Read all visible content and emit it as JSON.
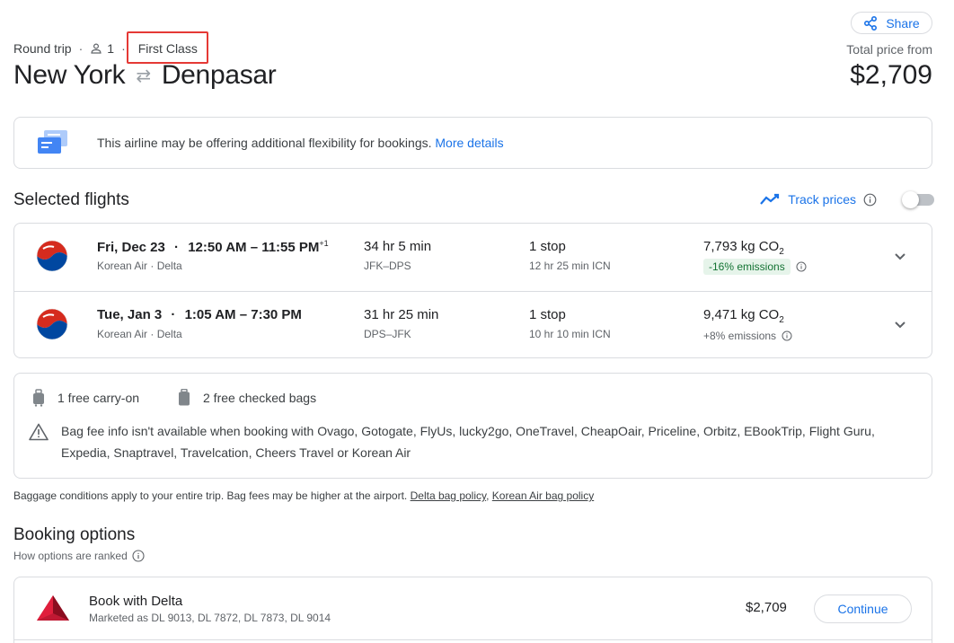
{
  "header": {
    "share_label": "Share",
    "trip_type": "Round trip",
    "passengers": "1",
    "cabin_class": "First Class",
    "origin": "New York",
    "destination": "Denpasar",
    "total_label": "Total price from",
    "total_price": "$2,709"
  },
  "notice": {
    "text": "This airline may be offering additional flexibility for bookings.",
    "link": "More details"
  },
  "selected_flights": {
    "title": "Selected flights",
    "track_label": "Track prices",
    "track_enabled": false,
    "flights": [
      {
        "date": "Fri, Dec 23",
        "times": "12:50 AM – 11:55 PM",
        "day_offset": "+1",
        "carrier": "Korean Air · Delta",
        "duration": "34 hr 5 min",
        "route": "JFK–DPS",
        "stops": "1 stop",
        "layover": "12 hr 25 min ICN",
        "co2": "7,793 kg CO",
        "co2_sub": "2",
        "emissions": "-16% emissions",
        "emissions_highlight": true
      },
      {
        "date": "Tue, Jan 3",
        "times": "1:05 AM – 7:30 PM",
        "day_offset": "",
        "carrier": "Korean Air · Delta",
        "duration": "31 hr 25 min",
        "route": "DPS–JFK",
        "stops": "1 stop",
        "layover": "10 hr 10 min ICN",
        "co2": "9,471 kg CO",
        "co2_sub": "2",
        "emissions": "+8% emissions",
        "emissions_highlight": false
      }
    ]
  },
  "bags": {
    "carry_on": "1 free carry-on",
    "checked": "2 free checked bags",
    "warning": "Bag fee info isn't available when booking with Ovago, Gotogate, FlyUs, lucky2go, OneTravel, CheapOair, Priceline, Orbitz, EBookTrip, Flight Guru, Expedia, Snaptravel, Travelcation, Cheers Travel or Korean Air"
  },
  "bag_note": {
    "text": "Baggage conditions apply to your entire trip. Bag fees may be higher at the airport.",
    "link1": "Delta bag policy",
    "separator": ",",
    "link2": "Korean Air bag policy"
  },
  "booking": {
    "title": "Booking options",
    "ranked_label": "How options are ranked",
    "options": [
      {
        "name": "Book with Delta",
        "marketed": "Marketed as DL 9013, DL 7872, DL 7873, DL 9014",
        "price": "$2,709",
        "button": "Continue"
      }
    ]
  },
  "colors": {
    "accent": "#1a73e8",
    "highlight_box": "#e53935",
    "emissions_badge_bg": "#e6f4ea",
    "emissions_badge_fg": "#137333",
    "delta_red": "#c01933"
  }
}
